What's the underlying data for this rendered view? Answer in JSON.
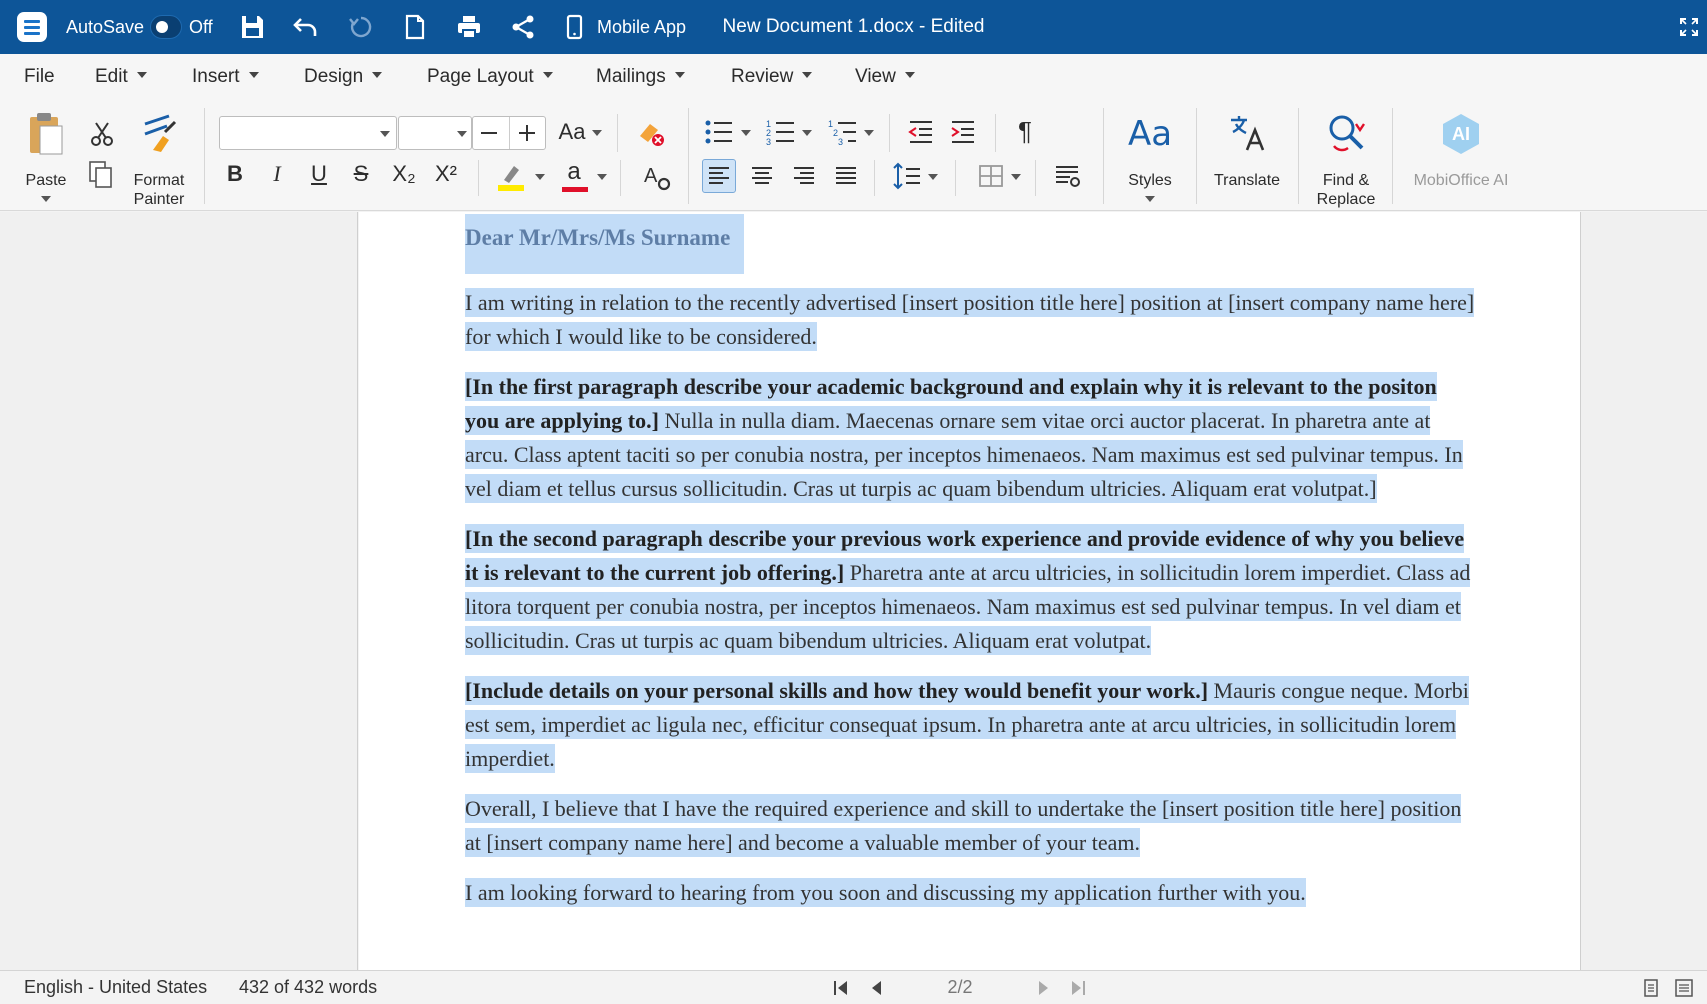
{
  "titlebar": {
    "autosave_label": "AutoSave",
    "autosave_state": "Off",
    "mobile_app_label": "Mobile App",
    "document_title": "New Document 1.docx - Edited"
  },
  "menubar": {
    "items": [
      "File",
      "Edit",
      "Insert",
      "Design",
      "Page Layout",
      "Mailings",
      "Review",
      "View"
    ]
  },
  "ribbon": {
    "paste_label": "Paste",
    "format_painter_label_1": "Format",
    "format_painter_label_2": "Painter",
    "font_name_value": "",
    "font_size_value": "",
    "change_case_label": "Aa",
    "bold_label": "B",
    "italic_label": "I",
    "underline_label": "U",
    "strike_label": "S",
    "subscript_label": "X₂",
    "superscript_label": "X²",
    "font_color_label": "a",
    "styles_label": "Styles",
    "styles_glyph": "Aa",
    "translate_label": "Translate",
    "find_replace_label_1": "Find &",
    "find_replace_label_2": "Replace",
    "ai_label": "MobiOffice AI",
    "ai_glyph": "AI",
    "highlight_color": "#ffeb00",
    "font_color": "#e0102a"
  },
  "document": {
    "greeting": "Dear Mr/Mrs/Ms Surname",
    "p1": "I am writing in relation to the recently advertised [insert position title here] position at [insert company name here] for which I would like to be considered.",
    "p2_bold": "[In the first paragraph describe your academic background and explain why it is relevant to the positon you are applying to.]",
    "p2_rest": " Nulla in nulla diam. Maecenas ornare sem vitae orci auctor placerat. In pharetra ante at arcu. Class aptent taciti so per conubia nostra, per inceptos himenaeos. Nam maximus est sed pulvinar tempus. In vel diam et tellus cursus sollicitudin. Cras ut turpis ac quam bibendum ultricies. Aliquam erat volutpat.]",
    "p3_bold": "[In the second paragraph describe your previous work experience and provide evidence of why you believe it is relevant to the current job offering.]",
    "p3_rest": " Pharetra ante at arcu ultricies, in sollicitudin lorem imperdiet. Class ad litora torquent per conubia nostra, per inceptos himenaeos. Nam maximus est sed pulvinar tempus. In vel diam et sollicitudin. Cras ut turpis ac quam bibendum ultricies. Aliquam erat volutpat.",
    "p4_bold": "[Include details on your personal skills and how they would benefit your work.]",
    "p4_rest": " Mauris congue neque. Morbi est sem, imperdiet ac ligula nec, efficitur consequat ipsum. In pharetra ante at arcu ultricies, in sollicitudin lorem imperdiet.",
    "p5": "Overall, I believe that I have the required experience and skill to undertake the [insert position title here] position at [insert company name here] and become a valuable member of your team.",
    "p6": "I am looking forward to hearing from you soon and discussing my application further with you."
  },
  "statusbar": {
    "language": "English - United States",
    "word_count": "432 of 432 words",
    "page_indicator": "2/2"
  },
  "colors": {
    "titlebar": "#0d5598",
    "selection": "#c2dcf7",
    "greeting": "#5e7ea6"
  }
}
